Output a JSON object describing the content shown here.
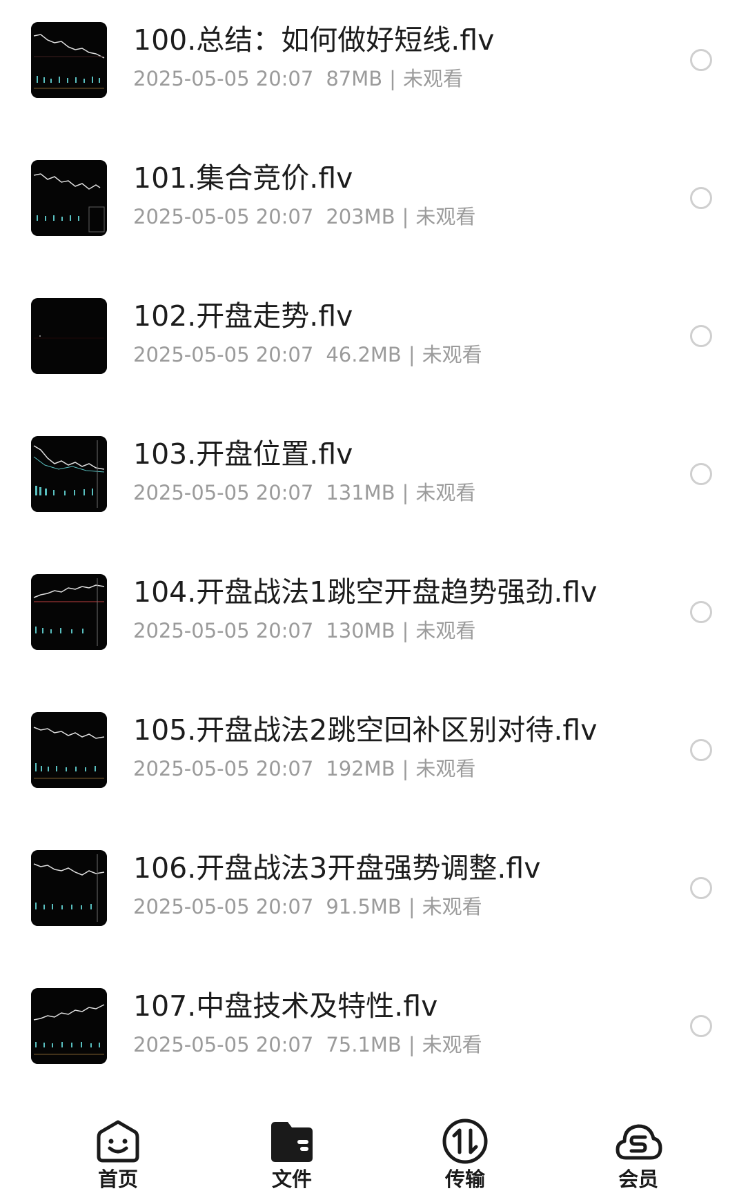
{
  "files": [
    {
      "name": "100.总结：如何做好短线.flv",
      "date": "2025-05-05 20:07",
      "size": "87MB",
      "status": "未观看"
    },
    {
      "name": "101.集合竞价.flv",
      "date": "2025-05-05 20:07",
      "size": "203MB",
      "status": "未观看"
    },
    {
      "name": "102.开盘走势.flv",
      "date": "2025-05-05 20:07",
      "size": "46.2MB",
      "status": "未观看"
    },
    {
      "name": "103.开盘位置.flv",
      "date": "2025-05-05 20:07",
      "size": "131MB",
      "status": "未观看"
    },
    {
      "name": "104.开盘战法1跳空开盘趋势强劲.flv",
      "date": "2025-05-05 20:07",
      "size": "130MB",
      "status": "未观看"
    },
    {
      "name": "105.开盘战法2跳空回补区别对待.flv",
      "date": "2025-05-05 20:07",
      "size": "192MB",
      "status": "未观看"
    },
    {
      "name": "106.开盘战法3开盘强势调整.flv",
      "date": "2025-05-05 20:07",
      "size": "91.5MB",
      "status": "未观看"
    },
    {
      "name": "107.中盘技术及特性.flv",
      "date": "2025-05-05 20:07",
      "size": "75.1MB",
      "status": "未观看"
    }
  ],
  "separator": "|",
  "tabbar": {
    "home": {
      "label": "首页",
      "icon": "smiley-face-icon"
    },
    "files": {
      "label": "文件",
      "icon": "folder-icon"
    },
    "transfer": {
      "label": "传输",
      "icon": "transfer-arrows-icon"
    },
    "vip": {
      "label": "会员",
      "icon": "cloud-s-icon"
    }
  },
  "colors": {
    "title": "#1c1c1c",
    "meta": "#9b9b9b",
    "circle": "#cfcfcf",
    "thumbnail_bg": "#050505",
    "tab_icon": "#1a1a1a"
  }
}
